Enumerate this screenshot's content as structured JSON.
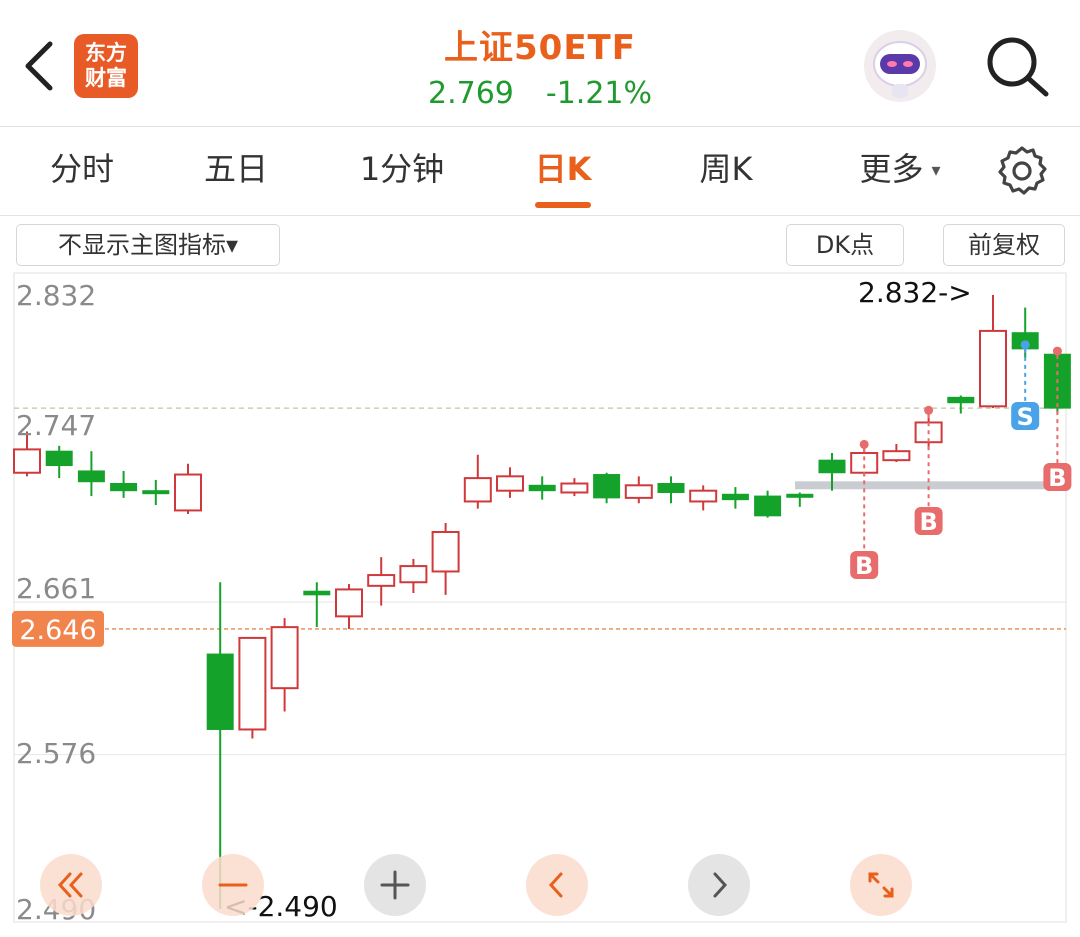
{
  "header": {
    "back_icon": "chevron-left-icon",
    "logo_line1": "东方",
    "logo_line2": "财富",
    "logo_color": "#e85b27",
    "title": "上证50ETF",
    "price": "2.769",
    "change_pct": "-1.21%",
    "price_color": "#1f9a2f",
    "assistant_icon": "robot-avatar-icon",
    "search_icon": "search-icon"
  },
  "tabs": {
    "items": [
      "分时",
      "五日",
      "1分钟",
      "日K",
      "周K",
      "更多"
    ],
    "active": "日K",
    "more_caret": "▾",
    "settings_icon": "gear-icon",
    "accent": "#e8601c"
  },
  "toolbar": {
    "indicator_select": "不显示主图指标▾",
    "dk_label": "DK点",
    "adjust_label": "前复权"
  },
  "chart_data": {
    "type": "candlestick",
    "up_color": "#d0393b",
    "down_color": "#15a22a",
    "y_ticks": [
      "2.832",
      "2.747",
      "2.661",
      "2.576",
      "2.490"
    ],
    "ylim": [
      2.49,
      2.832
    ],
    "grid": true,
    "max_annotation": "2.832->",
    "min_annotation": "<-2.490",
    "current_price_tag": "2.646",
    "reference_level": 2.769,
    "current_level": 2.646,
    "support_level": 2.726,
    "candles": [
      {
        "o": 2.733,
        "c": 2.746,
        "h": 2.756,
        "l": 2.731
      },
      {
        "o": 2.745,
        "c": 2.737,
        "h": 2.748,
        "l": 2.73
      },
      {
        "o": 2.734,
        "c": 2.728,
        "h": 2.745,
        "l": 2.72
      },
      {
        "o": 2.727,
        "c": 2.723,
        "h": 2.734,
        "l": 2.719
      },
      {
        "o": 2.723,
        "c": 2.722,
        "h": 2.729,
        "l": 2.715
      },
      {
        "o": 2.712,
        "c": 2.732,
        "h": 2.738,
        "l": 2.71
      },
      {
        "o": 2.632,
        "c": 2.59,
        "h": 2.672,
        "l": 2.49
      },
      {
        "o": 2.59,
        "c": 2.641,
        "h": 2.641,
        "l": 2.585
      },
      {
        "o": 2.613,
        "c": 2.647,
        "h": 2.652,
        "l": 2.6
      },
      {
        "o": 2.667,
        "c": 2.665,
        "h": 2.672,
        "l": 2.647
      },
      {
        "o": 2.653,
        "c": 2.668,
        "h": 2.671,
        "l": 2.646
      },
      {
        "o": 2.67,
        "c": 2.676,
        "h": 2.686,
        "l": 2.659
      },
      {
        "o": 2.672,
        "c": 2.681,
        "h": 2.685,
        "l": 2.666
      },
      {
        "o": 2.678,
        "c": 2.7,
        "h": 2.705,
        "l": 2.665
      },
      {
        "o": 2.717,
        "c": 2.73,
        "h": 2.743,
        "l": 2.713
      },
      {
        "o": 2.723,
        "c": 2.731,
        "h": 2.736,
        "l": 2.719
      },
      {
        "o": 2.726,
        "c": 2.723,
        "h": 2.731,
        "l": 2.718
      },
      {
        "o": 2.722,
        "c": 2.727,
        "h": 2.73,
        "l": 2.72
      },
      {
        "o": 2.732,
        "c": 2.719,
        "h": 2.733,
        "l": 2.716
      },
      {
        "o": 2.719,
        "c": 2.726,
        "h": 2.731,
        "l": 2.716
      },
      {
        "o": 2.727,
        "c": 2.722,
        "h": 2.731,
        "l": 2.716
      },
      {
        "o": 2.717,
        "c": 2.723,
        "h": 2.726,
        "l": 2.712
      },
      {
        "o": 2.721,
        "c": 2.718,
        "h": 2.725,
        "l": 2.713
      },
      {
        "o": 2.72,
        "c": 2.709,
        "h": 2.723,
        "l": 2.708
      },
      {
        "o": 2.721,
        "c": 2.72,
        "h": 2.722,
        "l": 2.714
      },
      {
        "o": 2.74,
        "c": 2.733,
        "h": 2.744,
        "l": 2.723
      },
      {
        "o": 2.733,
        "c": 2.744,
        "h": 2.751,
        "l": 2.731
      },
      {
        "o": 2.74,
        "c": 2.745,
        "h": 2.749,
        "l": 2.739
      },
      {
        "o": 2.75,
        "c": 2.761,
        "h": 2.77,
        "l": 2.746
      },
      {
        "o": 2.775,
        "c": 2.772,
        "h": 2.776,
        "l": 2.766
      },
      {
        "o": 2.77,
        "c": 2.812,
        "h": 2.832,
        "l": 2.769
      },
      {
        "o": 2.811,
        "c": 2.802,
        "h": 2.825,
        "l": 2.797
      },
      {
        "o": 2.799,
        "c": 2.769,
        "h": 2.803,
        "l": 2.766
      }
    ],
    "signals": [
      {
        "index": 26,
        "label": "B",
        "color": "#e86c6c"
      },
      {
        "index": 28,
        "label": "B",
        "color": "#e86c6c"
      },
      {
        "index": 31,
        "label": "S",
        "color": "#4aa3e8"
      },
      {
        "index": 32,
        "label": "B",
        "color": "#e86c6c"
      }
    ]
  },
  "controls": {
    "fast_back_icon": "double-chevron-left-icon",
    "zoom_out_icon": "minus-icon",
    "zoom_in_icon": "plus-icon",
    "prev_icon": "chevron-left-icon",
    "next_icon": "chevron-right-icon",
    "fullscreen_icon": "expand-icon"
  }
}
